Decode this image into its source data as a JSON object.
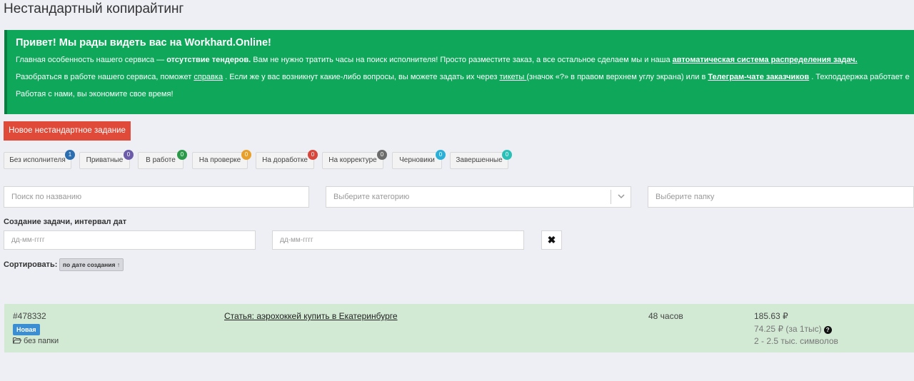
{
  "page": {
    "title": "Нестандартный копирайтинг"
  },
  "welcome": {
    "heading": "Привет! Мы рады видеть вас на Workhard.Online!",
    "p1_a": "Главная особенность нашего сервиса — ",
    "p1_bold": "отсутствие тендеров.",
    "p1_b": " Вам не нужно тратить часы на поиск исполнителя! Просто разместите заказ, а все остальное сделаем мы и наша ",
    "p1_link": "автоматическая система распределения задач.",
    "p2_a": "Разобраться в работе нашего сервиса, поможет ",
    "p2_link1": "справка",
    "p2_b": " . Если же у вас возникнут какие-либо вопросы, вы можете задать их через ",
    "p2_link2": "тикеты ",
    "p2_c": "(значок «?» в правом верхнем углу экрана) или в ",
    "p2_link3": "Телеграм-чате заказчиков",
    "p2_d": " . Техподдержка работает е",
    "p3": "Работая с нами, вы экономите свое время!"
  },
  "new_task_label": "Новое нестандартное задание",
  "filters": [
    {
      "label": "Без исполнителя",
      "count": "1",
      "color": "#2a6db0"
    },
    {
      "label": "Приватные",
      "count": "0",
      "color": "#6b5ba8"
    },
    {
      "label": "В работе",
      "count": "0",
      "color": "#2a9a4a"
    },
    {
      "label": "На проверке",
      "count": "0",
      "color": "#e8a02a"
    },
    {
      "label": "На доработке",
      "count": "0",
      "color": "#d9453a"
    },
    {
      "label": "На корректуре",
      "count": "0",
      "color": "#6c6c6c"
    },
    {
      "label": "Черновики",
      "count": "0",
      "color": "#2ab0d8"
    },
    {
      "label": "Завершенные",
      "count": "0",
      "color": "#2ac0b8"
    }
  ],
  "search": {
    "placeholder": "Поиск по названию"
  },
  "category": {
    "placeholder": "Выберите категорию"
  },
  "folder": {
    "placeholder": "Выберите папку"
  },
  "date_filter": {
    "label": "Создание задачи, интервал дат",
    "from_placeholder": "дд-мм-гггг",
    "to_placeholder": "дд-мм-гггг",
    "clear": "✖"
  },
  "sort": {
    "label": "Сортировать:",
    "button": "по дате создания ↑"
  },
  "task": {
    "id": "#478332",
    "badge": "Новая",
    "folder": "без папки",
    "title": "Статья: аэрохоккей купить в Екатеринбурге",
    "time": "48 часов",
    "price": "185.63 ₽",
    "rate": "74.25 ₽ (за 1тыс)",
    "size": "2 - 2.5 тыс. символов"
  },
  "colors": {
    "green": "#0fa75a",
    "red": "#e04a39",
    "row": "#d2ead4",
    "badge": "#3b8ed1"
  }
}
